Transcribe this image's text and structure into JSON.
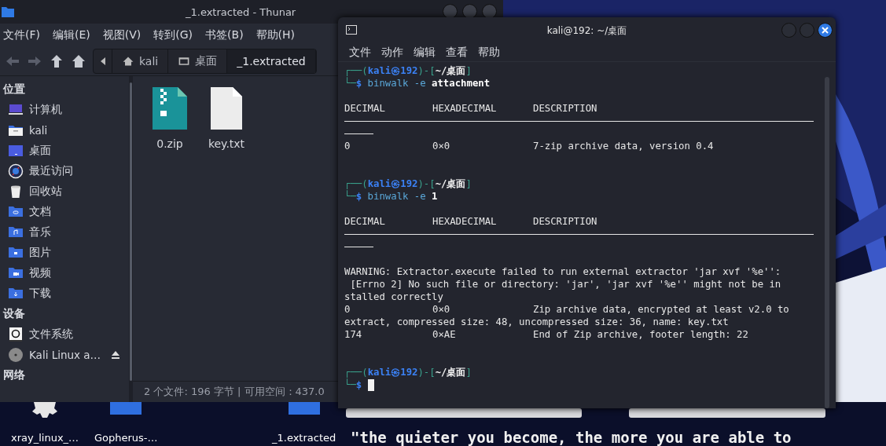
{
  "thunar": {
    "title": "_1.extracted - Thunar",
    "menu": [
      "文件(F)",
      "编辑(E)",
      "视图(V)",
      "转到(G)",
      "书签(B)",
      "帮助(H)"
    ],
    "toolbar": [
      {
        "kind": "back",
        "disabled": true
      },
      {
        "kind": "forward",
        "disabled": true
      },
      {
        "kind": "up",
        "disabled": false
      },
      {
        "kind": "home",
        "disabled": false
      }
    ],
    "pathbar": [
      {
        "label": "kali",
        "kind": "home",
        "selected": false
      },
      {
        "label": "桌面",
        "kind": "desktop",
        "selected": false
      },
      {
        "label": "_1.extracted",
        "kind": "folder",
        "selected": true
      }
    ],
    "sidebar": [
      {
        "heading": "位置",
        "items": [
          {
            "label": "计算机",
            "kind": "computer"
          },
          {
            "label": "kali",
            "kind": "home"
          },
          {
            "label": "桌面",
            "kind": "desktop"
          },
          {
            "label": "最近访问",
            "kind": "recent"
          },
          {
            "label": "回收站",
            "kind": "trash"
          },
          {
            "label": "文档",
            "kind": "documents"
          },
          {
            "label": "音乐",
            "kind": "music"
          },
          {
            "label": "图片",
            "kind": "pictures"
          },
          {
            "label": "视频",
            "kind": "videos"
          },
          {
            "label": "下载",
            "kind": "downloads"
          }
        ]
      },
      {
        "heading": "设备",
        "items": [
          {
            "label": "文件系统",
            "kind": "drive"
          },
          {
            "label": "Kali Linux a…",
            "kind": "disc",
            "eject": true
          }
        ]
      },
      {
        "heading": "网络"
      }
    ],
    "files": [
      {
        "name": "0.zip",
        "kind": "zip"
      },
      {
        "name": "key.txt",
        "kind": "text"
      }
    ],
    "status": "2 个文件: 196 字节 | 可用空间：437.0"
  },
  "terminal": {
    "title": "kali@192: ~/桌面",
    "menu": [
      "文件",
      "动作",
      "编辑",
      "查看",
      "帮助"
    ],
    "lines": [
      {
        "kind": "prompt",
        "segments": [
          {
            "text": "┌──(",
            "kind": "frame"
          },
          {
            "text": "kali㉿192",
            "kind": "user"
          },
          {
            "text": ")-[",
            "kind": "frame"
          },
          {
            "text": "~/桌面",
            "kind": "path"
          },
          {
            "text": "]",
            "kind": "frame"
          }
        ]
      },
      {
        "kind": "prompt",
        "segments": [
          {
            "text": "└─",
            "kind": "frame"
          },
          {
            "text": "$",
            "kind": "user"
          },
          {
            "text": " binwalk -e ",
            "kind": "command"
          },
          {
            "text": "attachment",
            "kind": "argument"
          }
        ]
      },
      {
        "kind": "blank"
      },
      {
        "kind": "columns",
        "cells": [
          "DECIMAL",
          "HEXADECIMAL",
          "DESCRIPTION"
        ]
      },
      {
        "kind": "rule"
      },
      {
        "kind": "rule_tail"
      },
      {
        "kind": "columns",
        "cells": [
          "0",
          "0×0",
          "7-zip archive data, version 0.4"
        ]
      },
      {
        "kind": "blank"
      },
      {
        "kind": "blank"
      },
      {
        "kind": "prompt",
        "segments": [
          {
            "text": "┌──(",
            "kind": "frame"
          },
          {
            "text": "kali㉿192",
            "kind": "user"
          },
          {
            "text": ")-[",
            "kind": "frame"
          },
          {
            "text": "~/桌面",
            "kind": "path"
          },
          {
            "text": "]",
            "kind": "frame"
          }
        ]
      },
      {
        "kind": "prompt",
        "segments": [
          {
            "text": "└─",
            "kind": "frame"
          },
          {
            "text": "$",
            "kind": "user"
          },
          {
            "text": " binwalk -e ",
            "kind": "command"
          },
          {
            "text": "1",
            "kind": "argument"
          }
        ]
      },
      {
        "kind": "blank"
      },
      {
        "kind": "columns",
        "cells": [
          "DECIMAL",
          "HEXADECIMAL",
          "DESCRIPTION"
        ]
      },
      {
        "kind": "rule"
      },
      {
        "kind": "rule_tail"
      },
      {
        "kind": "blank"
      },
      {
        "kind": "text",
        "text": "WARNING: Extractor.execute failed to run external extractor 'jar xvf '%e'':"
      },
      {
        "kind": "text",
        "text": " [Errno 2] No such file or directory: 'jar', 'jar xvf '%e'' might not be in"
      },
      {
        "kind": "text",
        "text": "stalled correctly"
      },
      {
        "kind": "columns",
        "cells": [
          "0",
          "0×0",
          "Zip archive data, encrypted at least v2.0 to"
        ]
      },
      {
        "kind": "text",
        "text": "extract, compressed size: 48, uncompressed size: 36, name: key.txt"
      },
      {
        "kind": "columns",
        "cells": [
          "174",
          "0×AE",
          "End of Zip archive, footer length: 22"
        ]
      },
      {
        "kind": "blank"
      },
      {
        "kind": "blank"
      },
      {
        "kind": "prompt",
        "segments": [
          {
            "text": "┌──(",
            "kind": "frame"
          },
          {
            "text": "kali㉿192",
            "kind": "user"
          },
          {
            "text": ")-[",
            "kind": "frame"
          },
          {
            "text": "~/桌面",
            "kind": "path"
          },
          {
            "text": "]",
            "kind": "frame"
          }
        ]
      },
      {
        "kind": "prompt",
        "cursor": true,
        "segments": [
          {
            "text": "└─",
            "kind": "frame"
          },
          {
            "text": "$",
            "kind": "user"
          }
        ]
      }
    ]
  },
  "desktop": {
    "icons": [
      {
        "label": "xray_linux_…",
        "kind": "gear"
      },
      {
        "label": "Gopherus-…",
        "kind": "folder"
      },
      {
        "label": "_1.extracted",
        "kind": "folder"
      }
    ],
    "slogan": "\"the quieter you become, the more you are able to"
  }
}
